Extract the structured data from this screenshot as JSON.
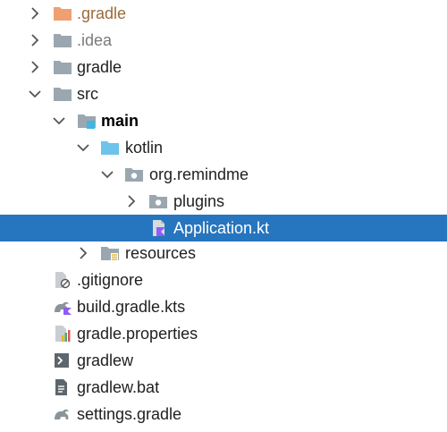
{
  "tree": {
    "items": [
      {
        "label": ".gradle",
        "icon": "folder-excluded-icon",
        "expanded": false
      },
      {
        "label": ".idea",
        "icon": "folder-icon",
        "expanded": false
      },
      {
        "label": "gradle",
        "icon": "folder-icon",
        "expanded": false
      },
      {
        "label": "src",
        "icon": "folder-icon",
        "expanded": true
      },
      {
        "label": "main",
        "icon": "module-folder-icon",
        "expanded": true
      },
      {
        "label": "kotlin",
        "icon": "source-root-folder-icon",
        "expanded": true
      },
      {
        "label": "org.remindme",
        "icon": "package-icon",
        "expanded": true
      },
      {
        "label": "plugins",
        "icon": "package-icon",
        "expanded": false
      },
      {
        "label": "Application.kt",
        "icon": "kotlin-file-icon",
        "selected": true
      },
      {
        "label": "resources",
        "icon": "resources-folder-icon",
        "expanded": false
      },
      {
        "label": ".gitignore",
        "icon": "ignore-file-icon"
      },
      {
        "label": "build.gradle.kts",
        "icon": "gradle-kotlin-file-icon"
      },
      {
        "label": "gradle.properties",
        "icon": "properties-file-icon"
      },
      {
        "label": "gradlew",
        "icon": "shell-script-icon"
      },
      {
        "label": "gradlew.bat",
        "icon": "batch-file-icon"
      },
      {
        "label": "settings.gradle",
        "icon": "gradle-file-icon"
      }
    ]
  },
  "colors": {
    "selection": "#2675bf",
    "folder": "#9aa7b0",
    "excluded_folder": "#f0a070",
    "source_root": "#6ec3ea",
    "module_badge": "#40b6e0",
    "kotlin": "#8f5cf7"
  }
}
